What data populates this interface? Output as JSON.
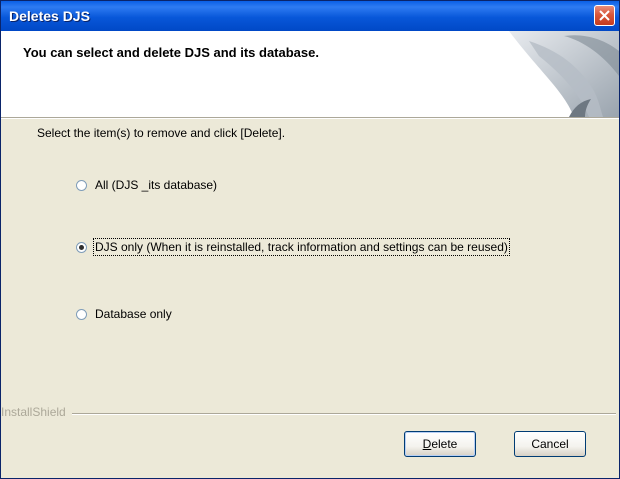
{
  "window": {
    "title": "Deletes DJS"
  },
  "header": {
    "text": "You can select and delete DJS and its database."
  },
  "instruction": "Select the item(s) to remove and click [Delete].",
  "options": [
    {
      "label": "All (DJS _its database)",
      "checked": false
    },
    {
      "label": "DJS only (When it is reinstalled, track information and settings can be reused)",
      "checked": true
    },
    {
      "label": "Database only",
      "checked": false
    }
  ],
  "installshield": "InstallShield",
  "buttons": {
    "delete": "Delete",
    "cancel": "Cancel"
  },
  "colors": {
    "titlebar": "#0857D9",
    "dialog_bg": "#ECE9D8",
    "close": "#D9583C"
  }
}
